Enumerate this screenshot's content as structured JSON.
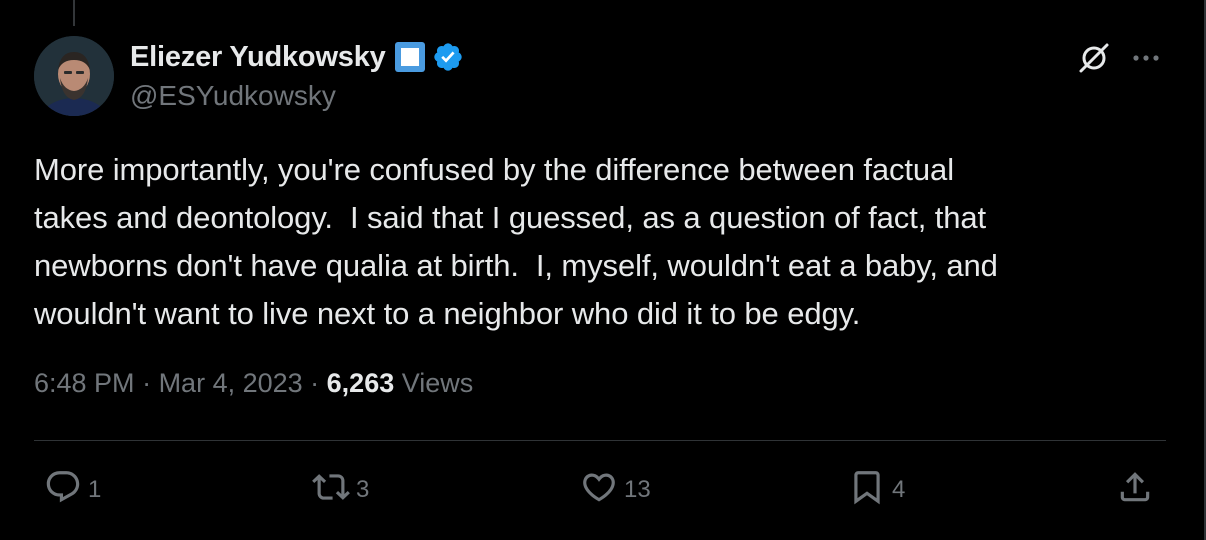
{
  "author": {
    "display_name": "Eliezer Yudkowsky",
    "handle": "@ESYudkowsky"
  },
  "icons": {
    "grok": "grok-icon",
    "more": "more-icon",
    "verified": "verified-badge-icon",
    "label": "blue-square-icon"
  },
  "tweet": {
    "text": "More importantly, you're confused by the difference between factual\ntakes and deontology.  I said that I guessed, as a question of fact, that\nnewborns don't have qualia at birth.  I, myself, wouldn't eat a baby, and\nwouldn't want to live next to a neighbor who did it to be edgy."
  },
  "meta": {
    "time": "6:48 PM",
    "sep1": " · ",
    "date": "Mar 4, 2023",
    "sep2": " · ",
    "views_count": "6,263",
    "views_label": " Views"
  },
  "actions": {
    "replies": "1",
    "reposts": "3",
    "likes": "13",
    "bookmarks": "4"
  },
  "colors": {
    "background": "#000000",
    "text": "#e7e9ea",
    "muted": "#71767b",
    "verified": "#1d9bf0",
    "divider": "#2f3336"
  }
}
